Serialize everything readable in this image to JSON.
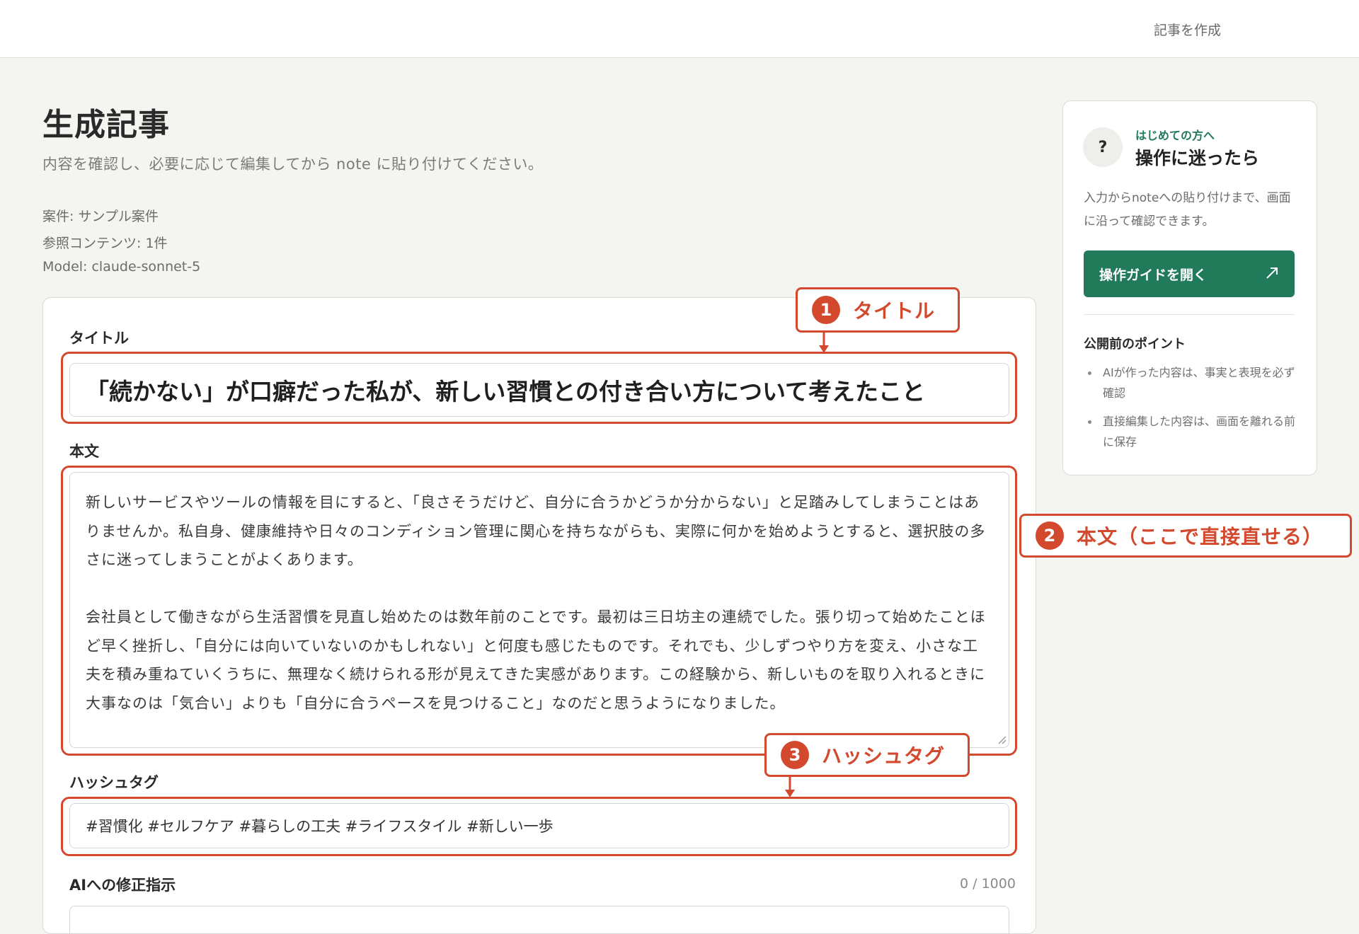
{
  "header": {
    "create_link": "記事を作成"
  },
  "page": {
    "title": "生成記事",
    "subtitle": "内容を確認し、必要に応じて編集してから note に貼り付けてください。",
    "meta_case": "案件: サンプル案件",
    "meta_ref": "参照コンテンツ: 1件",
    "meta_model": "Model: claude-sonnet-5"
  },
  "form": {
    "title_label": "タイトル",
    "title_value": "「続かない」が口癖だった私が、新しい習慣との付き合い方について考えたこと",
    "body_label": "本文",
    "body_value": "新しいサービスやツールの情報を目にすると、「良さそうだけど、自分に合うかどうか分からない」と足踏みしてしまうことはありませんか。私自身、健康維持や日々のコンディション管理に関心を持ちながらも、実際に何かを始めようとすると、選択肢の多さに迷ってしまうことがよくあります。\n\n会社員として働きながら生活習慣を見直し始めたのは数年前のことです。最初は三日坊主の連続でした。張り切って始めたことほど早く挫折し、「自分には向いていないのかもしれない」と何度も感じたものです。それでも、少しずつやり方を変え、小さな工夫を積み重ねていくうちに、無理なく続けられる形が見えてきた実感があります。この経験から、新しいものを取り入れるときに大事なのは「気合い」よりも「自分に合うペースを見つけること」なのだと思うようになりました。",
    "tags_label": "ハッシュタグ",
    "tags_value": "#習慣化 #セルフケア #暮らしの工夫 #ライフスタイル #新しい一歩",
    "ai_label": "AIへの修正指示",
    "ai_count": "0 / 1000"
  },
  "annotations": [
    {
      "num": "1",
      "label": "タイトル"
    },
    {
      "num": "2",
      "label": "本文（ここで直接直せる）"
    },
    {
      "num": "3",
      "label": "ハッシュタグ"
    }
  ],
  "help": {
    "eyebrow": "はじめての方へ",
    "title": "操作に迷ったら",
    "desc": "入力からnoteへの貼り付けまで、画面に沿って確認できます。",
    "button_label": "操作ガイドを開く",
    "tips_title": "公開前のポイント",
    "tips": [
      "AIが作った内容は、事実と表現を必ず確認",
      "直接編集した内容は、画面を離れる前に保存"
    ]
  },
  "colors": {
    "accent_green": "#217a5a",
    "annotation_red": "#d2492e",
    "page_bg": "#f4f4f0"
  },
  "icons": {
    "help": "question-mark-icon",
    "guide": "external-arrow-icon",
    "resize": "resize-grip-icon"
  }
}
